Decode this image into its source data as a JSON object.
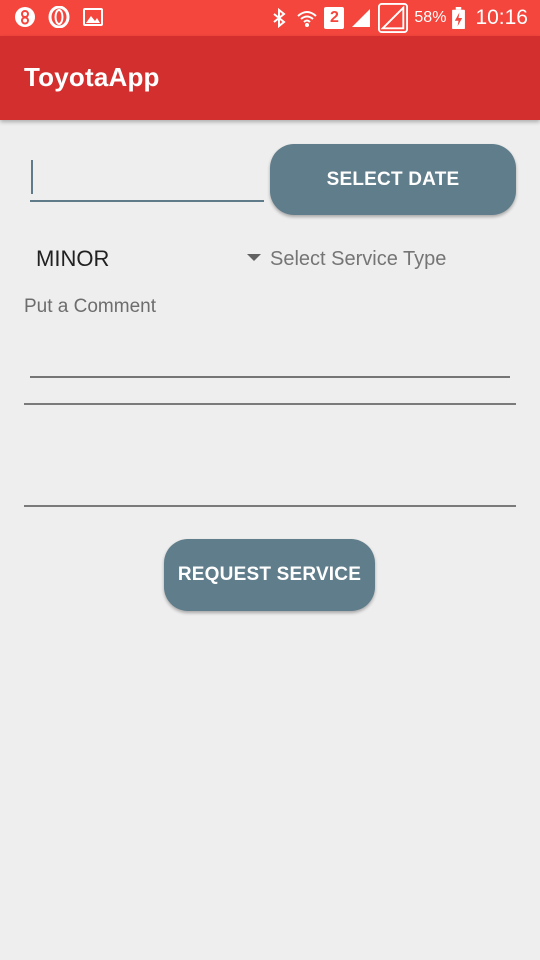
{
  "status_bar": {
    "icons_left": [
      "ring-notification-icon",
      "opera-icon",
      "gallery-icon"
    ],
    "icons_right": [
      "bluetooth-icon",
      "wifi-icon",
      "sim-2-icon",
      "signal-icon",
      "no-signal-icon"
    ],
    "sim_label": "2",
    "battery_percent": "58%",
    "time": "10:16",
    "color": "#f4463c"
  },
  "app_bar": {
    "title": "ToyotaApp",
    "color": "#d32f2f"
  },
  "form": {
    "date_input": {
      "value": "",
      "placeholder": ""
    },
    "select_date_label": "SELECT DATE",
    "service_type": {
      "selected": "MINOR",
      "hint": "Select Service Type"
    },
    "comment_label": "Put a Comment",
    "comment_value": "",
    "request_button_label": "REQUEST SERVICE"
  },
  "colors": {
    "button": "#607d8b",
    "background": "#eeeeee"
  }
}
